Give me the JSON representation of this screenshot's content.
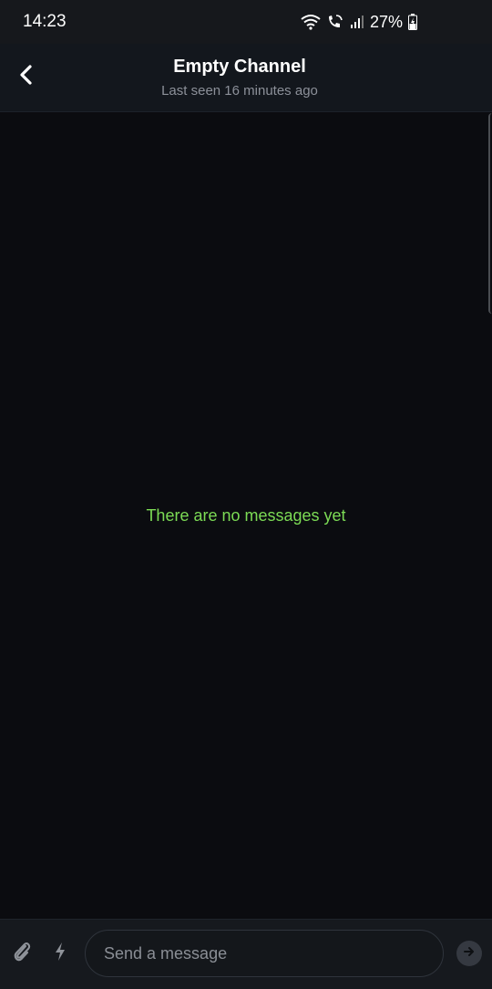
{
  "status_bar": {
    "time": "14:23",
    "battery_percent": "27%",
    "icons": [
      "wifi-icon",
      "wifi-calling-icon",
      "signal-icon",
      "battery-charging-icon"
    ]
  },
  "header": {
    "title": "Empty Channel",
    "subtitle": "Last seen 16 minutes ago",
    "back_icon": "chevron-left-icon"
  },
  "messages": {
    "empty_text": "There are no messages yet"
  },
  "composer": {
    "placeholder": "Send a message",
    "value": "",
    "attach_icon": "paperclip-icon",
    "commands_icon": "lightning-icon",
    "send_icon": "send-arrow-icon"
  },
  "colors": {
    "background": "#0b0c10",
    "header_bg": "#13171d",
    "accent_green": "#7cdb55",
    "muted_text": "#8c9099"
  }
}
